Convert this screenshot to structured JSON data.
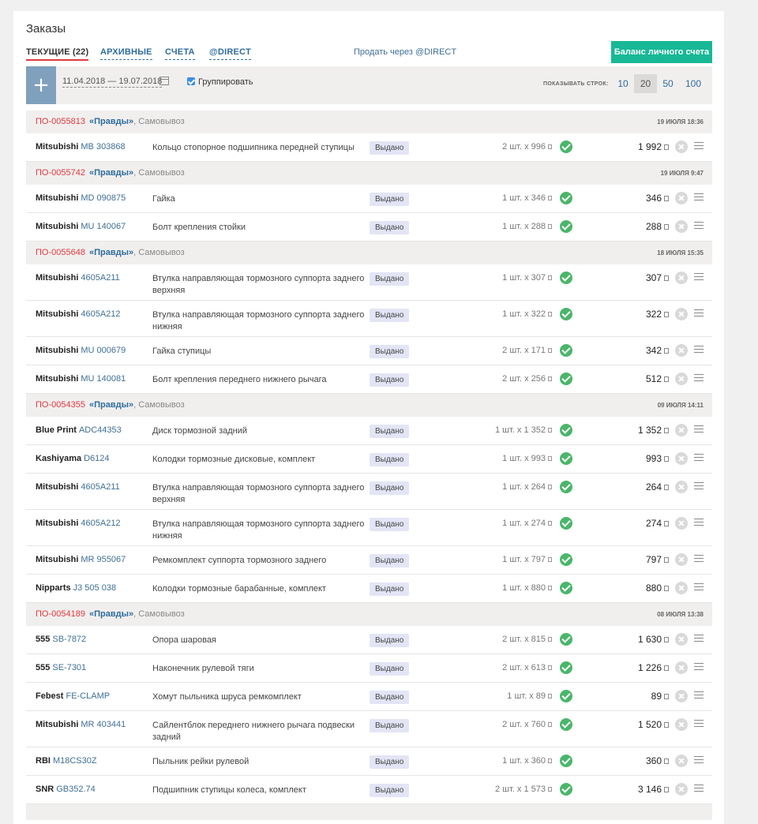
{
  "page": {
    "title": "Заказы"
  },
  "tabs": [
    {
      "label": "ТЕКУЩИЕ (22)",
      "active": true
    },
    {
      "label": "АРХИВНЫЕ",
      "active": false
    },
    {
      "label": "СЧЕТА",
      "active": false
    },
    {
      "label": "@DIRECT",
      "active": false
    }
  ],
  "header": {
    "sell_link": "Продать через @DIRECT",
    "balance_button": "Баланс личного счета"
  },
  "toolbar": {
    "add_label": "+",
    "date_range": "11.04.2018 — 19.07.2018",
    "group_label": "Группировать",
    "group_checked": true,
    "rows_label": "ПОКАЗЫВАТЬ СТРОК:",
    "page_sizes": [
      "10",
      "20",
      "50",
      "100"
    ],
    "active_page_size": "20"
  },
  "colors": {
    "accent": "#18b896",
    "order_red": "#e0393e",
    "link_blue": "#2e6c9e",
    "ok_green": "#4ab66a"
  },
  "icons": {
    "add": "plus-icon",
    "calendar": "calendar-icon",
    "ok": "check-circle-icon",
    "cancel": "cancel-circle-icon",
    "menu": "menu-icon",
    "currency": "ruble-icon"
  },
  "orders": [
    {
      "number": "ПО-0055813",
      "shop": "«Правды»",
      "delivery": ", Самовывоз",
      "date": "19 ИЮЛЯ 18:36",
      "items": [
        {
          "brand": "Mitsubishi",
          "code": "MB 303868",
          "desc": "Кольцо стопорное подшипника передней ступицы",
          "status": "Выдано",
          "qty": "2 шт. x 996",
          "sum": "1 992"
        }
      ]
    },
    {
      "number": "ПО-0055742",
      "shop": "«Правды»",
      "delivery": ", Самовывоз",
      "date": "19 ИЮЛЯ 9:47",
      "items": [
        {
          "brand": "Mitsubishi",
          "code": "MD 090875",
          "desc": "Гайка",
          "status": "Выдано",
          "qty": "1 шт. x 346",
          "sum": "346"
        },
        {
          "brand": "Mitsubishi",
          "code": "MU 140067",
          "desc": "Болт крепления стойки",
          "status": "Выдано",
          "qty": "1 шт. x 288",
          "sum": "288"
        }
      ]
    },
    {
      "number": "ПО-0055648",
      "shop": "«Правды»",
      "delivery": ", Самовывоз",
      "date": "18 ИЮЛЯ 15:35",
      "items": [
        {
          "brand": "Mitsubishi",
          "code": "4605A211",
          "desc": "Втулка направляющая тормозного суппорта заднего верхняя",
          "status": "Выдано",
          "qty": "1 шт. x 307",
          "sum": "307"
        },
        {
          "brand": "Mitsubishi",
          "code": "4605A212",
          "desc": "Втулка направляющая тормозного суппорта заднего нижняя",
          "status": "Выдано",
          "qty": "1 шт. x 322",
          "sum": "322"
        },
        {
          "brand": "Mitsubishi",
          "code": "MU 000679",
          "desc": "Гайка ступицы",
          "status": "Выдано",
          "qty": "2 шт. x 171",
          "sum": "342"
        },
        {
          "brand": "Mitsubishi",
          "code": "MU 140081",
          "desc": "Болт крепления переднего нижнего рычага",
          "status": "Выдано",
          "qty": "2 шт. x 256",
          "sum": "512"
        }
      ]
    },
    {
      "number": "ПО-0054355",
      "shop": "«Правды»",
      "delivery": ", Самовывоз",
      "date": "09 ИЮЛЯ 14:11",
      "items": [
        {
          "brand": "Blue Print",
          "code": "ADC44353",
          "desc": "Диск тормозной задний",
          "status": "Выдано",
          "qty": "1 шт. x 1 352",
          "sum": "1 352"
        },
        {
          "brand": "Kashiyama",
          "code": "D6124",
          "desc": "Колодки тормозные дисковые, комплект",
          "status": "Выдано",
          "qty": "1 шт. x 993",
          "sum": "993"
        },
        {
          "brand": "Mitsubishi",
          "code": "4605A211",
          "desc": "Втулка направляющая тормозного суппорта заднего верхняя",
          "status": "Выдано",
          "qty": "1 шт. x 264",
          "sum": "264"
        },
        {
          "brand": "Mitsubishi",
          "code": "4605A212",
          "desc": "Втулка направляющая тормозного суппорта заднего нижняя",
          "status": "Выдано",
          "qty": "1 шт. x 274",
          "sum": "274"
        },
        {
          "brand": "Mitsubishi",
          "code": "MR 955067",
          "desc": "Ремкомплект суппорта тормозного заднего",
          "status": "Выдано",
          "qty": "1 шт. x 797",
          "sum": "797"
        },
        {
          "brand": "Nipparts",
          "code": "J3 505 038",
          "desc": "Колодки тормозные барабанные, комплект",
          "status": "Выдано",
          "qty": "1 шт. x 880",
          "sum": "880"
        }
      ]
    },
    {
      "number": "ПО-0054189",
      "shop": "«Правды»",
      "delivery": ", Самовывоз",
      "date": "08 ИЮЛЯ 13:38",
      "items": [
        {
          "brand": "555",
          "code": "SB-7872",
          "desc": "Опора шаровая",
          "status": "Выдано",
          "qty": "2 шт. x 815",
          "sum": "1 630"
        },
        {
          "brand": "555",
          "code": "SE-7301",
          "desc": "Наконечник рулевой тяги",
          "status": "Выдано",
          "qty": "2 шт. x 613",
          "sum": "1 226"
        },
        {
          "brand": "Febest",
          "code": "FE-CLAMP",
          "desc": "Хомут пыльника шруса ремкомплект",
          "status": "Выдано",
          "qty": "1 шт. x 89",
          "sum": "89"
        },
        {
          "brand": "Mitsubishi",
          "code": "MR 403441",
          "desc": "Сайлентблок переднего нижнего рычага подвески задний",
          "status": "Выдано",
          "qty": "2 шт. x 760",
          "sum": "1 520"
        },
        {
          "brand": "RBI",
          "code": "M18CS30Z",
          "desc": "Пыльник рейки рулевой",
          "status": "Выдано",
          "qty": "1 шт. x 360",
          "sum": "360"
        },
        {
          "brand": "SNR",
          "code": "GB352.74",
          "desc": "Подшипник ступицы колеса, комплект",
          "status": "Выдано",
          "qty": "2 шт. x 1 573",
          "sum": "3 146"
        }
      ]
    }
  ]
}
